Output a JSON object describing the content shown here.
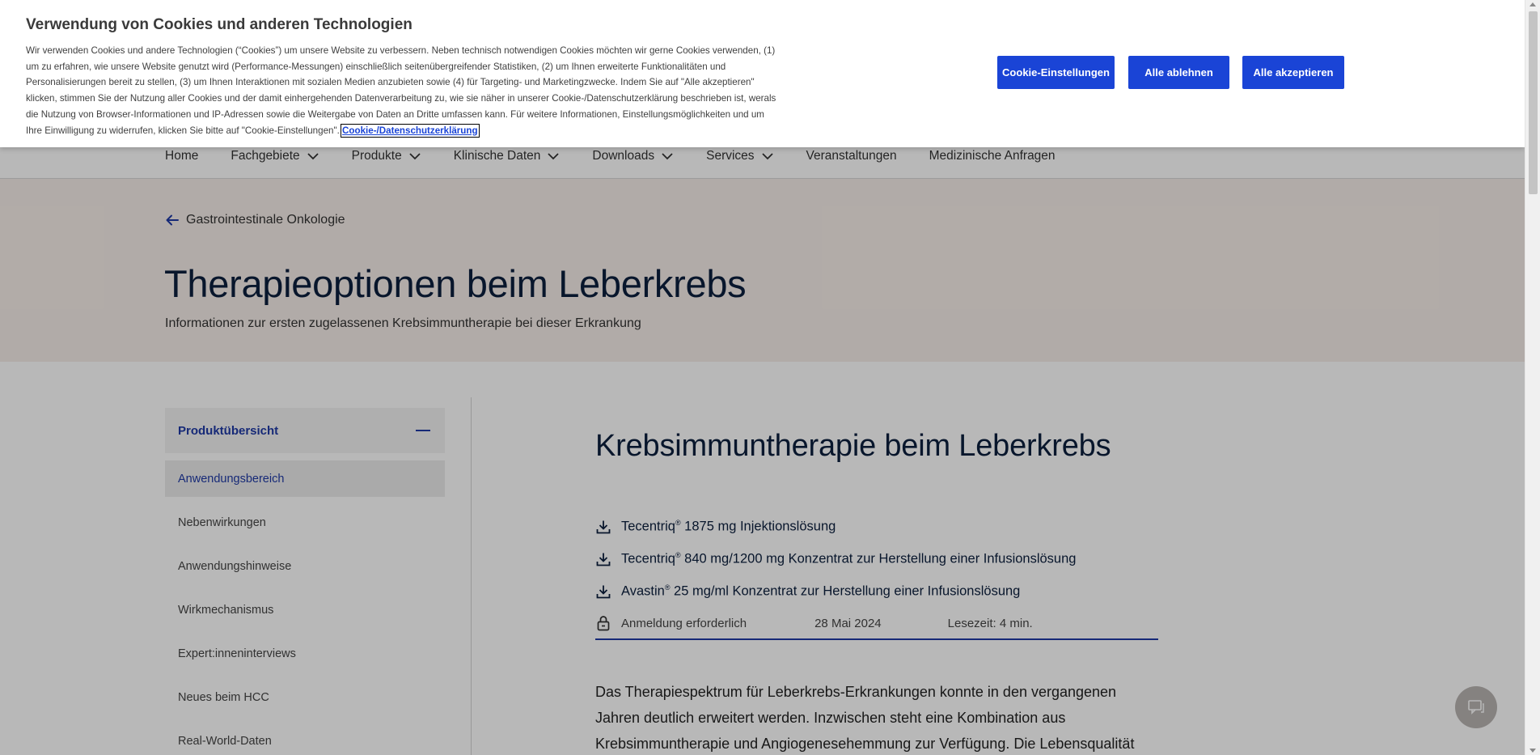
{
  "cookie_banner": {
    "title": "Verwendung von Cookies und anderen Technologien",
    "text_lines": [
      "Wir verwenden Cookies und andere Technologien (“Cookies”) um unsere Website zu verbessern. Neben technisch notwendigen Cookies möchten wir gerne Cookies verwenden, (1)",
      "um zu erfahren, wie unsere Website genutzt wird (Performance-Messungen) einschließlich seitenübergreifender Statistiken, (2) um Ihnen erweiterte Funktionalitäten und",
      "Personalisierungen bereit zu stellen, (3) um Ihnen Interaktionen mit sozialen Medien anzubieten sowie (4) für Targeting- und Marketingzwecke. Indem Sie auf \"Alle akzeptieren\"",
      "klicken, stimmen Sie der Nutzung aller Cookies und der damit einhergehenden Datenverarbeitung zu, wie sie näher in unserer Cookie-/Datenschutzerklärung beschrieben ist, werals",
      "die Nutzung von Browser-Informationen und IP-Adressen sowie die Weitergabe von Daten an Dritte umfassen kann. Für weitere Informationen, Einstellungsmöglichkeiten und um",
      "Ihre Einwilligung zu widerrufen, klicken Sie bitte auf \"Cookie-Einstellungen\"."
    ],
    "link_label": "Cookie-/Datenschutzerklärung",
    "buttons": {
      "settings": "Cookie-Einstellungen",
      "reject": "Alle ablehnen",
      "accept": "Alle akzeptieren"
    },
    "accent_color": "#1a44d6"
  },
  "nav": {
    "items": [
      {
        "label": "Home",
        "has_dropdown": false
      },
      {
        "label": "Fachgebiete",
        "has_dropdown": true
      },
      {
        "label": "Produkte",
        "has_dropdown": true
      },
      {
        "label": "Klinische Daten",
        "has_dropdown": true
      },
      {
        "label": "Downloads",
        "has_dropdown": true
      },
      {
        "label": "Services",
        "has_dropdown": true
      },
      {
        "label": "Veranstaltungen",
        "has_dropdown": false
      },
      {
        "label": "Medizinische Anfragen",
        "has_dropdown": false
      }
    ]
  },
  "hero": {
    "back_label": "Gastrointestinale Onkologie",
    "back_icon": "arrow-left-icon",
    "title": "Therapieoptionen beim Leberkrebs",
    "subtitle": "Informationen zur ersten zugelassenen Krebsimmuntherapie bei dieser Erkrankung",
    "background": "#f6eee9"
  },
  "sidebar": {
    "header": "Produktübersicht",
    "items": [
      {
        "label": "Anwendungsbereich",
        "active": true
      },
      {
        "label": "Nebenwirkungen",
        "active": false
      },
      {
        "label": "Anwendungshinweise",
        "active": false
      },
      {
        "label": "Wirkmechanismus",
        "active": false
      },
      {
        "label": "Expert:inneninterviews",
        "active": false
      },
      {
        "label": "Neues beim HCC",
        "active": false
      },
      {
        "label": "Real-World-Daten",
        "active": false
      }
    ]
  },
  "article": {
    "title": "Krebsimmuntherapie beim Leberkrebs",
    "downloads": [
      {
        "brand": "Tecentriq",
        "rest": " 1875 mg Injektionslösung"
      },
      {
        "brand": "Tecentriq",
        "rest": " 840 mg/1200 mg Konzentrat zur Herstellung einer Infusionslösung"
      },
      {
        "brand": "Avastin",
        "rest": " 25 mg/ml Konzentrat zur Herstellung einer Infusionslösung"
      }
    ],
    "registered_mark": "®",
    "meta": {
      "login": "Anmeldung erforderlich",
      "date": "28 Mai 2024",
      "reading_time": "Lesezeit: 4 min."
    },
    "body_lines": [
      "Das Therapiespektrum für Leberkrebs-Erkrankungen konnte in den vergangenen",
      "Jahren deutlich erweitert werden. Inzwischen steht eine Kombination aus",
      "Krebsimmuntherapie und Angiogenesehemmung zur Verfügung. Die Lebensqualität"
    ]
  }
}
